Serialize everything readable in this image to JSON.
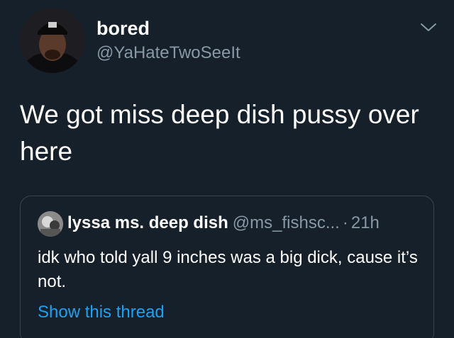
{
  "tweet": {
    "author": {
      "display_name": "bored",
      "handle": "@YaHateTwoSeeIt",
      "avatar_icon": "profile-photo"
    },
    "menu_icon": "chevron-down-icon",
    "text": "We got miss deep dish pussy over here"
  },
  "quoted_tweet": {
    "author": {
      "display_name": "lyssa ms. deep dish",
      "handle": "@ms_fishsc...",
      "separator": "·",
      "time": "21h",
      "avatar_icon": "profile-photo"
    },
    "text": "idk who told yall 9 inches was a big dick, cause it’s not.",
    "thread_link": "Show this thread"
  },
  "colors": {
    "background": "#15202b",
    "primary_text": "#ffffff",
    "secondary_text": "#8899a6",
    "link": "#1da1f2",
    "border": "#38444d"
  }
}
